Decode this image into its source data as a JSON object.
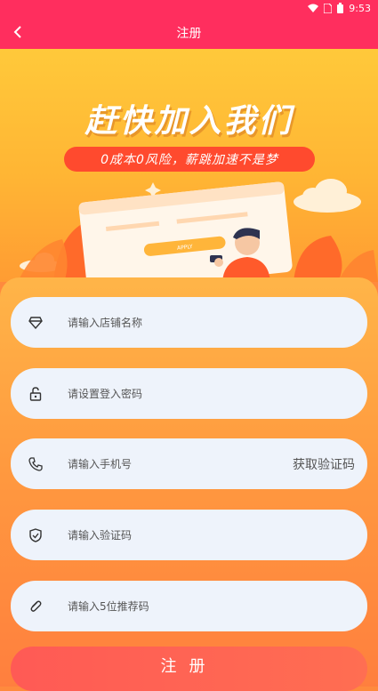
{
  "status_bar": {
    "time": "9:53",
    "icons": [
      "wifi-icon",
      "sim-icon",
      "battery-icon"
    ]
  },
  "header": {
    "title": "注册",
    "back_icon": "chevron-left-icon"
  },
  "banner": {
    "headline": "赶快加入我们",
    "subtitle": "0成本0风险，薪跳加速不是梦"
  },
  "form": {
    "fields": [
      {
        "icon": "diamond-icon",
        "placeholder": "请输入店铺名称"
      },
      {
        "icon": "lock-icon",
        "placeholder": "请设置登入密码"
      },
      {
        "icon": "phone-icon",
        "placeholder": "请输入手机号",
        "action": "获取验证码"
      },
      {
        "icon": "shield-icon",
        "placeholder": "请输入验证码"
      },
      {
        "icon": "paperclip-icon",
        "placeholder": "请输入5位推荐码"
      }
    ],
    "submit_label": "注册"
  },
  "colors": {
    "header_bg": "#ff2e5e",
    "banner_top": "#ffc93a",
    "form_bg_bottom": "#ff7f3e",
    "field_bg": "#eef3fb",
    "submit_bg": "#ff5a55"
  }
}
